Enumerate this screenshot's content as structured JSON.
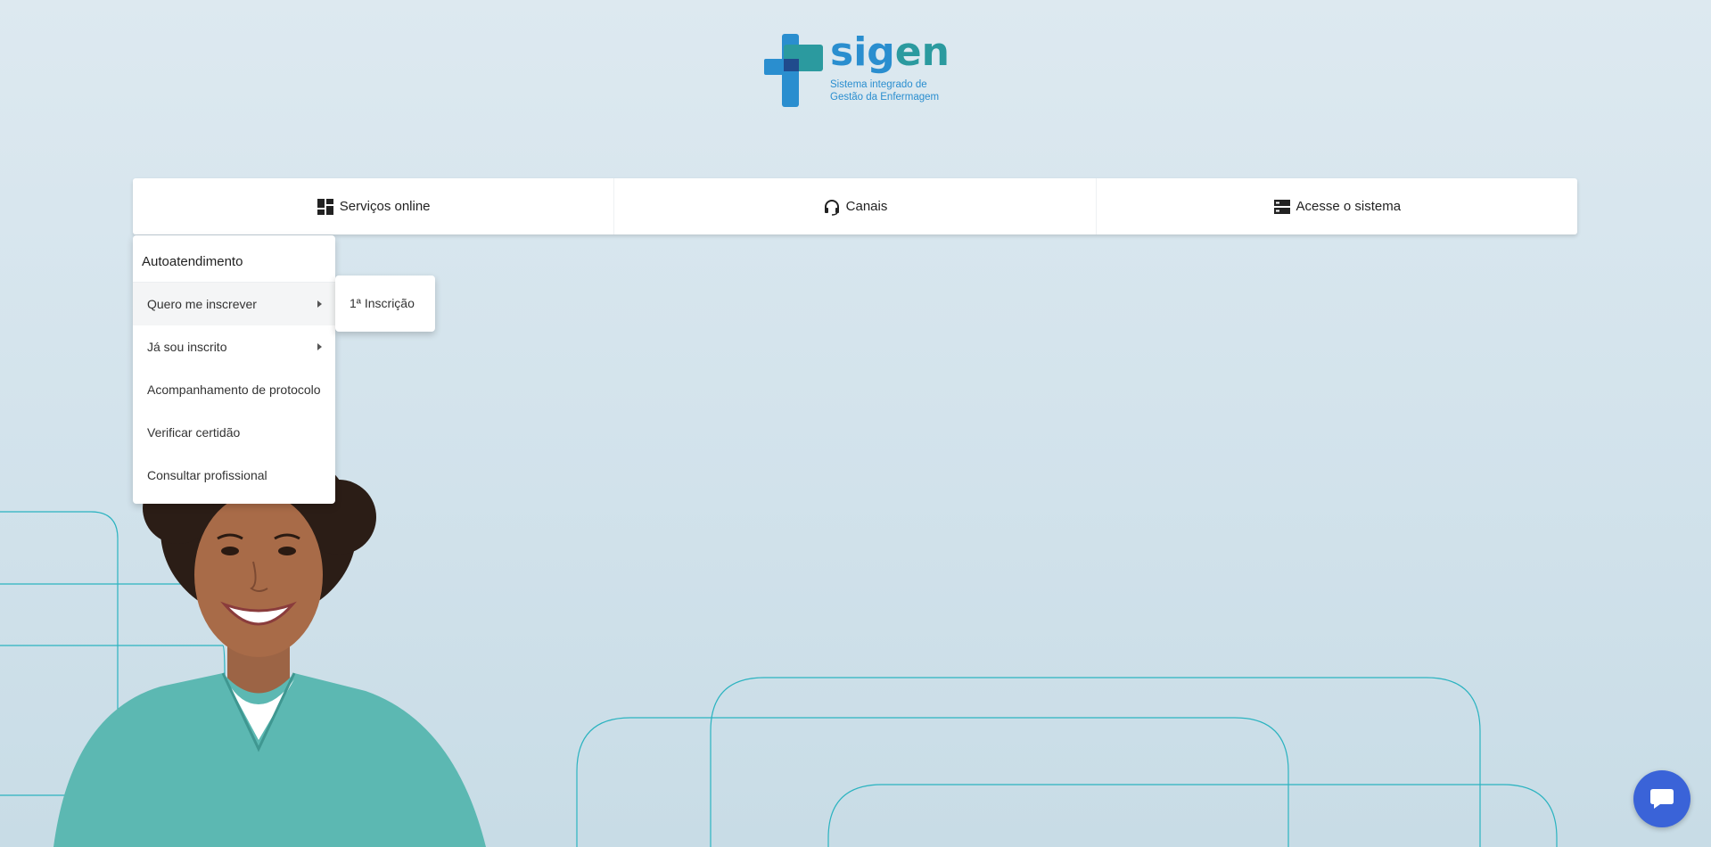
{
  "logo": {
    "wordmark_part1": "sig",
    "wordmark_part2": "en",
    "tagline_line1": "Sistema integrado de",
    "tagline_line2": "Gestão da Enfermagem",
    "colors": {
      "blue": "#2a8ecf",
      "teal": "#2b9a9f",
      "dark": "#1f3d8a"
    }
  },
  "nav": {
    "items": [
      {
        "label": "Serviços online",
        "icon": "dashboard-icon"
      },
      {
        "label": "Canais",
        "icon": "headset-icon"
      },
      {
        "label": "Acesse o sistema",
        "icon": "server-icon"
      }
    ]
  },
  "menu": {
    "header": "Autoatendimento",
    "items": [
      {
        "label": "Quero me inscrever",
        "has_submenu": true,
        "active": true
      },
      {
        "label": "Já sou inscrito",
        "has_submenu": true,
        "active": false
      },
      {
        "label": "Acompanhamento de protocolo",
        "has_submenu": false,
        "active": false
      },
      {
        "label": "Verificar certidão",
        "has_submenu": false,
        "active": false
      },
      {
        "label": "Consultar profissional",
        "has_submenu": false,
        "active": false
      }
    ]
  },
  "submenu": {
    "items": [
      {
        "label": "1ª Inscrição"
      }
    ]
  },
  "chat": {
    "icon": "chat-bubble-icon",
    "color": "#3a63d8"
  },
  "theme": {
    "accent_line": "#2bb3c0",
    "scrub_color": "#5cb8b2"
  }
}
